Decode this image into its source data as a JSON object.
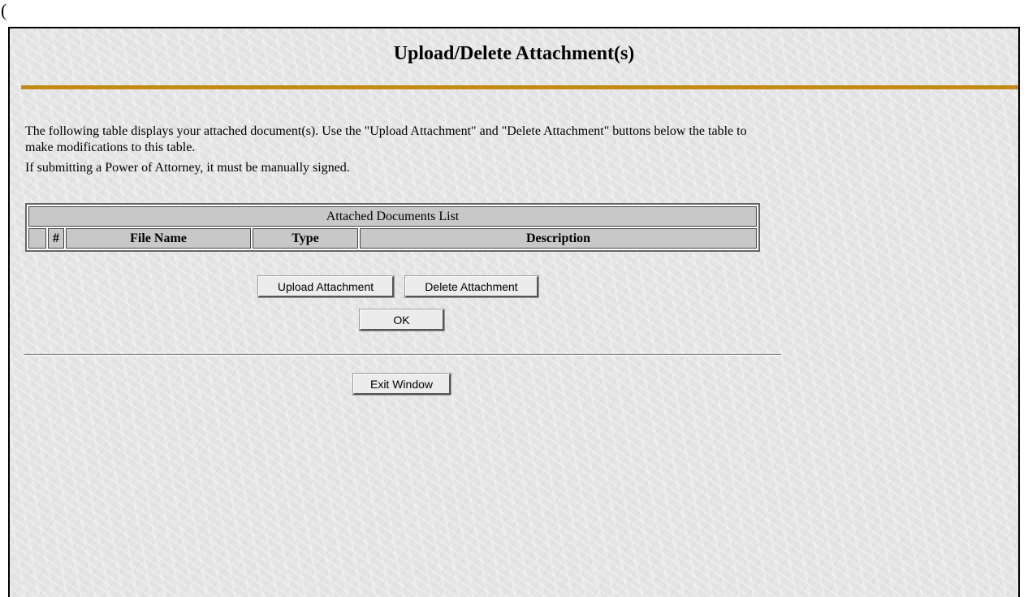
{
  "stray_char": "(",
  "page": {
    "title": "Upload/Delete Attachment(s)",
    "intro_line1": "The following table displays your attached document(s).  Use the \"Upload Attachment\" and \"Delete Attachment\" buttons below the table to make modifications to this table.",
    "intro_line2": "If submitting a Power of Attorney, it must be manually signed."
  },
  "table": {
    "caption": "Attached Documents List",
    "columns": [
      "",
      "#",
      "File Name",
      "Type",
      "Description"
    ],
    "rows": []
  },
  "buttons": {
    "upload": "Upload Attachment",
    "delete": "Delete Attachment",
    "ok": "OK",
    "exit": "Exit Window"
  },
  "colors": {
    "rule_gold": "#c48a16",
    "header_cell": "#c8c8c8",
    "background": "#e4e4e4"
  }
}
